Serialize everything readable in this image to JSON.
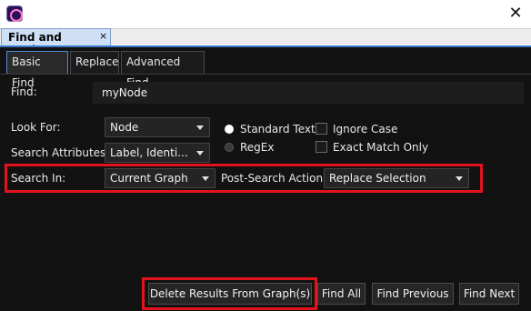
{
  "window": {
    "close_glyph": "✕"
  },
  "dock_tab": {
    "label": "Find and Replace",
    "close_glyph": "×"
  },
  "tabs": [
    {
      "label": "Basic Find",
      "active": true
    },
    {
      "label": "Replace",
      "active": false
    },
    {
      "label": "Advanced Find",
      "active": false
    }
  ],
  "find": {
    "label": "Find:",
    "value": "myNode"
  },
  "look_for": {
    "label": "Look For:",
    "value": "Node"
  },
  "search_attributes": {
    "label": "Search Attributes:",
    "value": "Label, Identi..."
  },
  "search_mode": {
    "standard_text": {
      "label": "Standard Text",
      "selected": true
    },
    "regex": {
      "label": "RegEx",
      "selected": false
    }
  },
  "options": {
    "ignore_case": {
      "label": "Ignore Case",
      "checked": false
    },
    "exact_match": {
      "label": "Exact Match Only",
      "checked": false
    }
  },
  "search_in": {
    "label": "Search In:",
    "value": "Current Graph"
  },
  "post_search_action": {
    "label": "Post-Search Action:",
    "value": "Replace Selection"
  },
  "buttons": {
    "delete_results": "Delete Results From Graph(s)",
    "find_all": "Find All",
    "find_previous": "Find Previous",
    "find_next": "Find Next"
  },
  "colors": {
    "panel_bg": "#121212",
    "highlight": "#e3131e",
    "accent": "#3c78c8"
  }
}
